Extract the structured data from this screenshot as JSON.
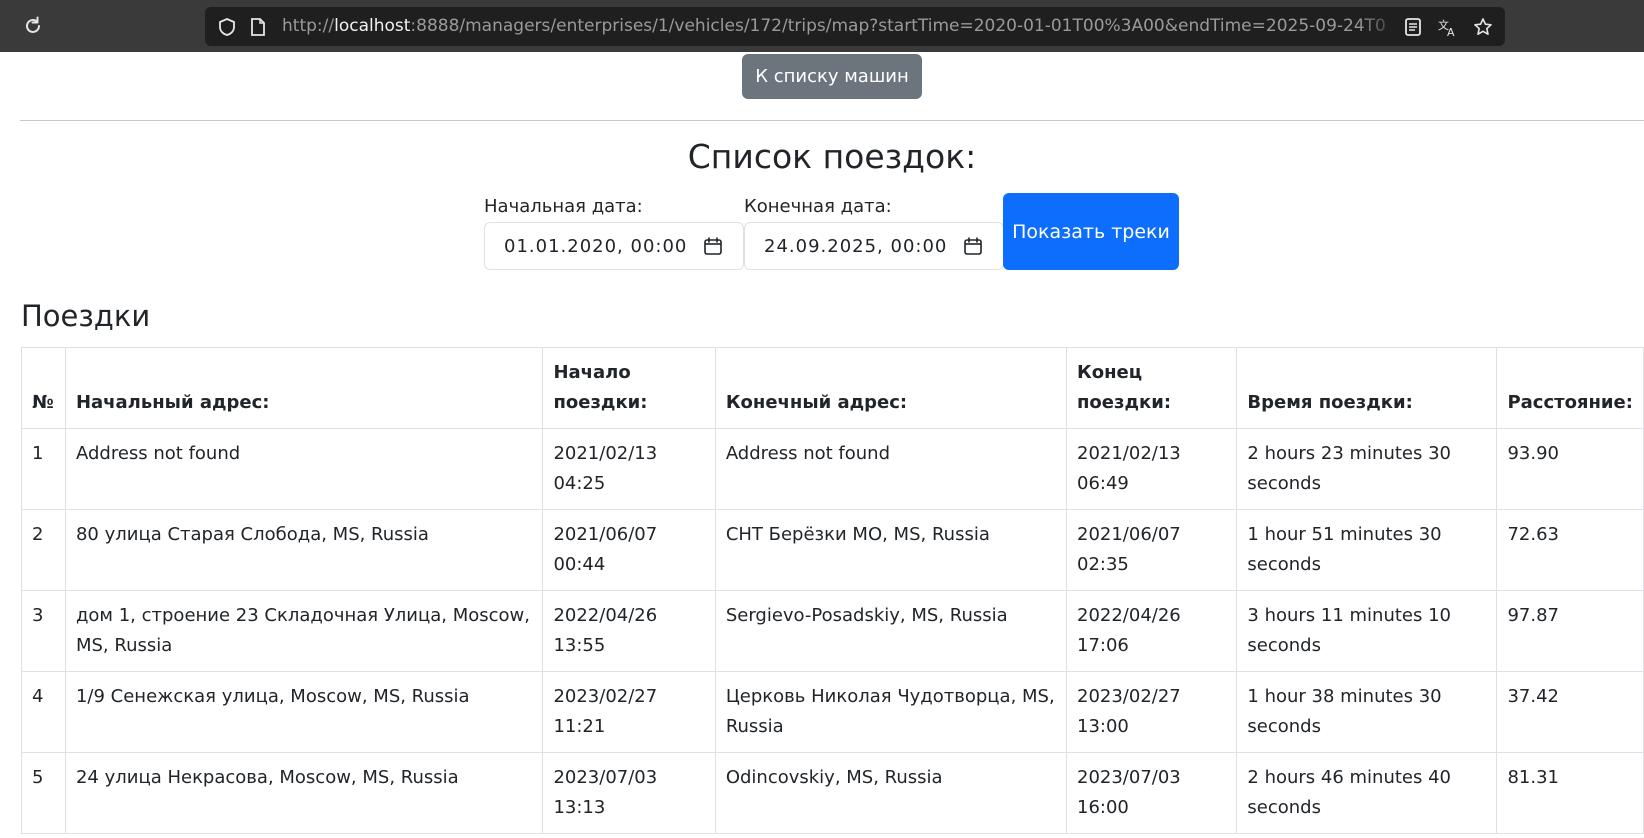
{
  "browser": {
    "url_prefix": "http://",
    "url_host": "localhost",
    "url_rest": ":8888/managers/enterprises/1/vehicles/172/trips/map?startTime=2020-01-01T00%3A00&endTime=2025-09-24T0"
  },
  "page": {
    "back_button": "К списку машин",
    "title": "Список поездок:",
    "start_label": "Начальная дата:",
    "start_value": "01.01.2020, 00:00",
    "end_label": "Конечная дата:",
    "end_value": "24.09.2025, 00:00",
    "show_button": "Показать треки",
    "trips_heading": "Поездки"
  },
  "table": {
    "headers": [
      "№",
      "Начальный адрес:",
      "Начало поездки:",
      "Конечный адрес:",
      "Конец поездки:",
      "Время поездки:",
      "Расстояние:"
    ],
    "rows": [
      [
        "1",
        "Address not found",
        "2021/02/13 04:25",
        "Address not found",
        "2021/02/13 06:49",
        "2 hours 23 minutes 30 seconds",
        "93.90"
      ],
      [
        "2",
        "80 улица Старая Слобода, MS, Russia",
        "2021/06/07 00:44",
        "СНТ Берёзки МО, MS, Russia",
        "2021/06/07 02:35",
        "1 hour 51 minutes 30 seconds",
        "72.63"
      ],
      [
        "3",
        "дом 1, строение 23 Складочная Улица, Moscow, MS, Russia",
        "2022/04/26 13:55",
        "Sergievo-Posadskiy, MS, Russia",
        "2022/04/26 17:06",
        "3 hours 11 minutes 10 seconds",
        "97.87"
      ],
      [
        "4",
        "1/9 Сенежская улица, Moscow, MS, Russia",
        "2023/02/27 11:21",
        "Церковь Николая Чудотворца, MS, Russia",
        "2023/02/27 13:00",
        "1 hour 38 minutes 30 seconds",
        "37.42"
      ],
      [
        "5",
        "24 улица Некрасова, Moscow, MS, Russia",
        "2023/07/03 13:13",
        "Odincovskiy, MS, Russia",
        "2023/07/03 16:00",
        "2 hours 46 minutes 40 seconds",
        "81.31"
      ]
    ]
  },
  "colors": {
    "primary": "#0d6efd",
    "secondary": "#6c757d",
    "toolbar": "#3a3a3a"
  },
  "icons": [
    "reload-icon",
    "shield-icon",
    "page-icon",
    "reader-icon",
    "translate-icon",
    "star-icon",
    "calendar-icon"
  ]
}
